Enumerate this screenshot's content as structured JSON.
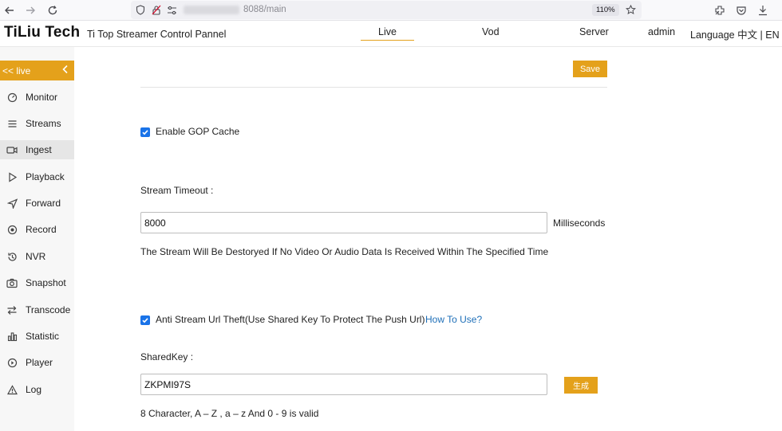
{
  "browser": {
    "url_suffix": "8088/main",
    "zoom": "110%"
  },
  "header": {
    "logo": "TiLiu Tech",
    "subtitle": "Ti Top Streamer Control Pannel",
    "nav": {
      "live": "Live",
      "vod": "Vod",
      "server": "Server",
      "admin": "admin",
      "language": "Language 中文 | EN"
    }
  },
  "sidebar": {
    "head_label": "<<  live",
    "items": [
      {
        "label": "Monitor",
        "icon": "monitor-icon"
      },
      {
        "label": "Streams",
        "icon": "streams-icon"
      },
      {
        "label": "Ingest",
        "icon": "ingest-icon"
      },
      {
        "label": "Playback",
        "icon": "playback-icon"
      },
      {
        "label": "Forward",
        "icon": "forward-icon"
      },
      {
        "label": "Record",
        "icon": "record-icon"
      },
      {
        "label": "NVR",
        "icon": "nvr-icon"
      },
      {
        "label": "Snapshot",
        "icon": "snapshot-icon"
      },
      {
        "label": "Transcode",
        "icon": "transcode-icon"
      },
      {
        "label": "Statistic",
        "icon": "statistic-icon"
      },
      {
        "label": "Player",
        "icon": "player-icon"
      },
      {
        "label": "Log",
        "icon": "log-icon"
      }
    ],
    "active_item": "Ingest"
  },
  "main": {
    "save_label": "Save",
    "gop_cache": {
      "label": "Enable GOP Cache",
      "checked": true
    },
    "stream_timeout": {
      "label": "Stream Timeout :",
      "value": "8000",
      "unit": "Milliseconds",
      "help": "The Stream Will Be Destoryed If No Video Or Audio Data Is Received Within The Specified Time"
    },
    "anti_theft": {
      "label": "Anti Stream Url Theft(Use Shared Key To Protect The Push Url)",
      "checked": true,
      "link": "How To Use?"
    },
    "shared_key": {
      "label": "SharedKey :",
      "value": "ZKPMI97S",
      "generate_label": "生成",
      "help": "8 Character, A – Z , a – z And 0 - 9 is valid"
    }
  },
  "colors": {
    "accent": "#e4a11b",
    "checkbox": "#1a73e8",
    "link": "#1e6fb8"
  }
}
